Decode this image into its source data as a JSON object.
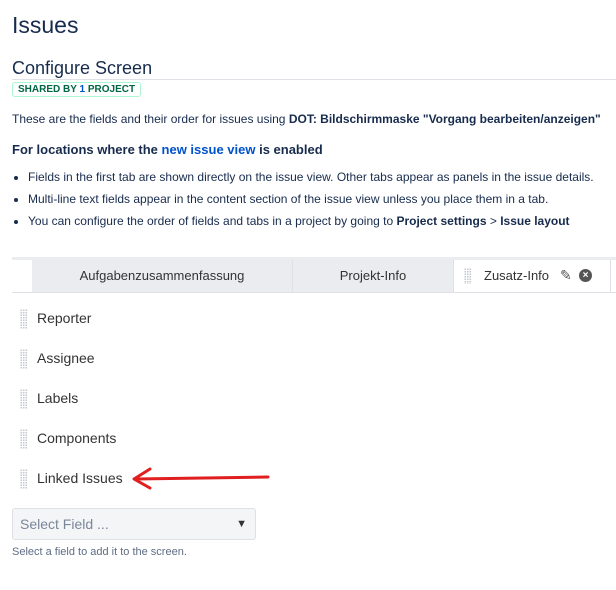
{
  "page_title": "Issues",
  "section_title": "Configure Screen",
  "badge": {
    "prefix": "SHARED BY",
    "count": "1",
    "suffix": "PROJECT"
  },
  "intro": {
    "text": "These are the fields and their order for issues using ",
    "screen_name": "DOT: Bildschirmmaske \"Vorgang bearbeiten/anzeigen\""
  },
  "locations": {
    "prefix": "For locations where the ",
    "link": "new issue view",
    "suffix": " is enabled"
  },
  "bullets": [
    "Fields in the first tab are shown directly on the issue view. Other tabs appear as panels in the issue details.",
    "Multi-line text fields appear in the content section of the issue view unless you place them in a tab."
  ],
  "bullet3": {
    "text": "You can configure the order of fields and tabs in a project by going to ",
    "b1": "Project settings",
    "sep": " > ",
    "b2": "Issue layout"
  },
  "tabs": [
    {
      "label": "Aufgabenzusammenfassung"
    },
    {
      "label": "Projekt-Info"
    },
    {
      "label": "Zusatz-Info"
    }
  ],
  "fields": [
    "Reporter",
    "Assignee",
    "Labels",
    "Components",
    "Linked Issues"
  ],
  "select": {
    "placeholder": "Select Field ..."
  },
  "help": "Select a field to add it to the screen.",
  "annotation_color": "#e02020"
}
